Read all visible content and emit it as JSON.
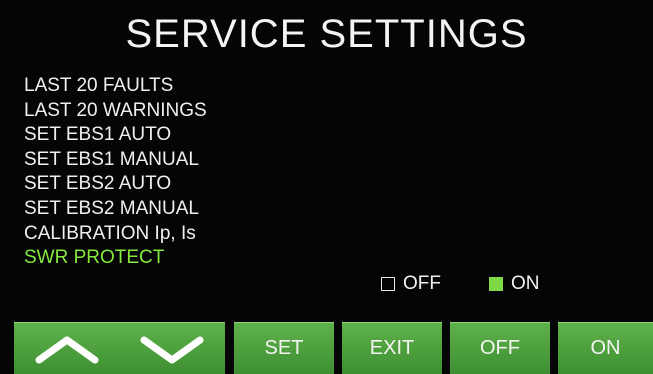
{
  "header": {
    "title": "SERVICE SETTINGS"
  },
  "menu": {
    "items": [
      {
        "label": "LAST 20 FAULTS"
      },
      {
        "label": "LAST 20 WARNINGS"
      },
      {
        "label": "SET EBS1 AUTO"
      },
      {
        "label": "SET EBS1 MANUAL"
      },
      {
        "label": "SET EBS2 AUTO"
      },
      {
        "label": "SET EBS2 MANUAL"
      },
      {
        "label": "CALIBRATION Ip, Is"
      },
      {
        "label": "SWR PROTECT"
      }
    ],
    "selected_index": 7
  },
  "swr_protect": {
    "off_label": "OFF",
    "on_label": "ON",
    "state": "on"
  },
  "buttons": {
    "up_icon": "chevron-up-icon",
    "down_icon": "chevron-down-icon",
    "set_label": "SET",
    "exit_label": "EXIT",
    "off_label": "OFF",
    "on_label": "ON"
  },
  "colors": {
    "selected_text": "#84ea3e",
    "button_green": "#4fa33f",
    "indicator_on": "#7fd946"
  }
}
